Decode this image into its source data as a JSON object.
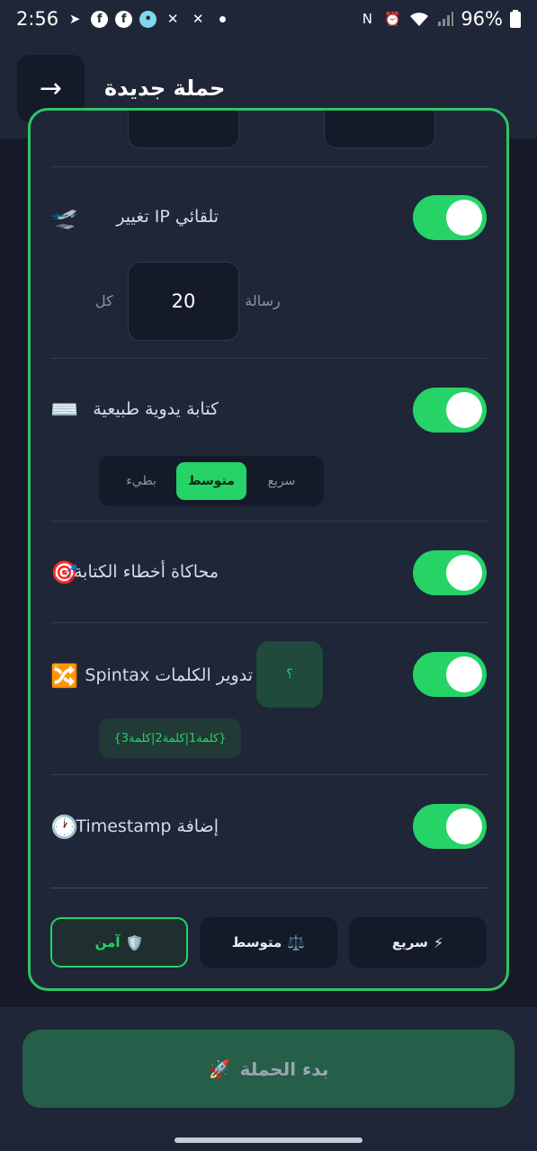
{
  "status_bar": {
    "time": "2:56",
    "battery": "96%",
    "icons_left": [
      "telegram-icon",
      "facebook-icon",
      "facebook-icon",
      "app-icon",
      "x-icon",
      "x-icon"
    ],
    "icons_right": [
      "nfc-icon",
      "alarm-icon",
      "wifi-icon",
      "signal-icon",
      "battery-icon"
    ]
  },
  "header": {
    "title": "حملة جديدة",
    "back_icon": "→"
  },
  "rows": {
    "ip_change": {
      "label": "تلقائي IP تغيير",
      "emoji": "🛫",
      "enabled": true
    },
    "ip_interval": {
      "prefix": "رسالة",
      "value": "20",
      "suffix": "كل"
    },
    "typing": {
      "label": "كتابة يدوية طبيعية",
      "emoji": "⌨️",
      "enabled": true
    },
    "typing_speed": {
      "options": [
        "سريع",
        "متوسط",
        "بطيء"
      ],
      "selected": "متوسط"
    },
    "typos": {
      "label": "محاكاة أخطاء الكتابة",
      "emoji": "🎯",
      "enabled": true
    },
    "spintax": {
      "label": "تدوير الكلمات Spintax",
      "emoji": "🔀",
      "enabled": true,
      "help": "؟",
      "example": "{كلمة1|كلمة2|كلمة3}"
    },
    "timestamp": {
      "label": "إضافة Timestamp",
      "emoji": "🕐",
      "enabled": true
    }
  },
  "modes": {
    "safe": {
      "label": "آمن",
      "icon": "🛡️"
    },
    "medium": {
      "label": "متوسط",
      "icon": "⚖️"
    },
    "fast": {
      "label": "سريع",
      "icon": "⚡"
    },
    "selected": "آمن"
  },
  "start_button": {
    "label": "بدء الحملة",
    "icon": "🚀"
  },
  "colors": {
    "accent": "#25d366",
    "card_border": "#2fc466",
    "background": "#161a28",
    "surface": "#1f2638"
  }
}
